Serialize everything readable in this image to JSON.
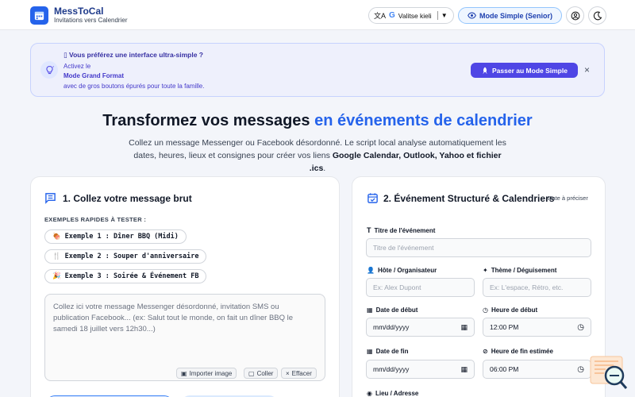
{
  "header": {
    "app_title": "MessToCal",
    "app_subtitle": "Invitations vers Calendrier",
    "language_button": "Valitse kieli",
    "mode_button": "Mode Simple (Senior)"
  },
  "banner": {
    "title": "Vous préférez une interface ultra-simple ?",
    "line1": "Activez le",
    "line2": "Mode Grand Format",
    "line3": "avec de gros boutons épurés pour toute la famille.",
    "switch_button": "Passer au Mode Simple",
    "close": "×"
  },
  "hero": {
    "title_main": "Transformez vos messages",
    "title_accent": "en événements de calendrier",
    "desc_line1": "Collez un message Messenger ou Facebook désordonné. Le script local analyse automatiquement les",
    "desc_line2": "dates, heures, lieux et consignes pour créer vos liens",
    "desc_bold": "Google Calendar, Outlook, Yahoo et fichier .ics",
    "desc_end": "."
  },
  "left_card": {
    "title": "1. Collez votre message brut",
    "quick_label": "EXEMPLES RAPIDES À TESTER :",
    "examples": [
      {
        "label": "Exemple 1 : Dîner BBQ (Midi)",
        "icon": "🍖"
      },
      {
        "label": "Exemple 2 : Souper d'anniversaire",
        "icon": "🍴"
      },
      {
        "label": "Exemple 3 : Soirée & Événement FB",
        "icon": "🎉"
      }
    ],
    "textarea_placeholder": "Collez ici votre message Messenger désordonné, invitation SMS ou publication Facebook... (ex: Salut tout le monde, on fait un dîner BBQ le samedi 18 juillet vers 12h30...)",
    "btn_import": "Importer image",
    "btn_paste": "Coller",
    "btn_clear": "Effacer"
  },
  "right_card": {
    "title": "2. Événement Structuré & Calendriers",
    "badge": "Date à préciser",
    "fields": {
      "event_title_label": "Titre de l'événement",
      "event_title_placeholder": "Titre de l'événement",
      "host_label": "Hôte / Organisateur",
      "host_placeholder": "Ex: Alex Dupont",
      "theme_label": "Thème / Déguisement",
      "theme_placeholder": "Ex: L'espace, Rétro, etc.",
      "start_date_label": "Date de début",
      "start_date_value": "mm/dd/yyyy",
      "start_time_label": "Heure de début",
      "start_time_value": "12:00 PM",
      "end_date_label": "Date de fin",
      "end_date_value": "mm/dd/yyyy",
      "end_time_label": "Heure de fin estimée",
      "end_time_value": "06:00 PM",
      "location_label": "Lieu / Adresse"
    }
  },
  "colors": {
    "accent": "#2563eb",
    "indigo": "#4f46e5",
    "background": "#f3f5fa"
  }
}
